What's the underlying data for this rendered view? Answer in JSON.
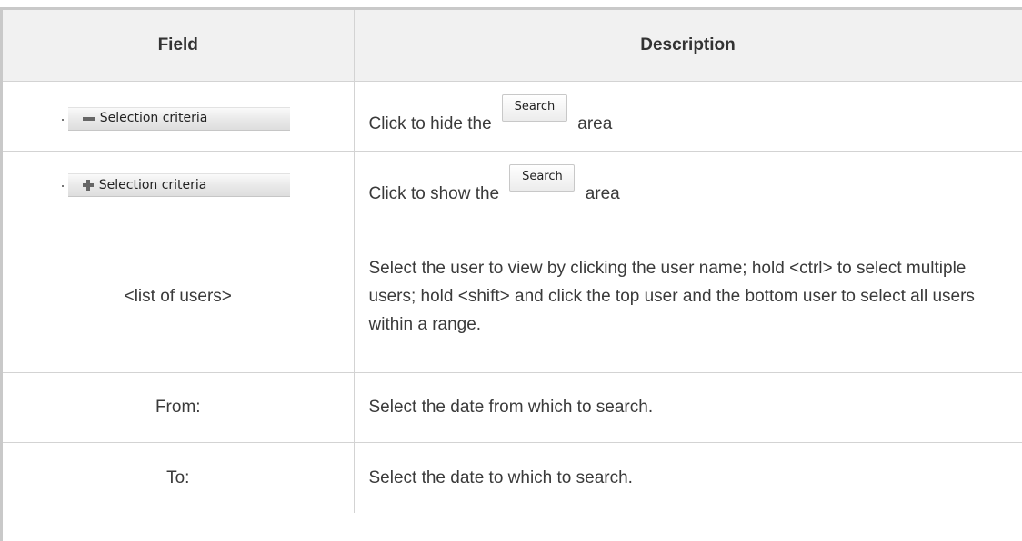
{
  "table": {
    "headers": {
      "field": "Field",
      "description": "Description"
    },
    "rows": {
      "hide": {
        "field_button_label": "Selection criteria",
        "field_button_icon": "minus-icon",
        "desc_before": "Click to hide the",
        "desc_button": "Search",
        "desc_after": "area"
      },
      "show": {
        "field_button_label": "Selection criteria",
        "field_button_icon": "plus-icon",
        "desc_before": "Click to show the",
        "desc_button": "Search",
        "desc_after": "area"
      },
      "list": {
        "field": "<list of users>",
        "desc": "Select the user to view by clicking the user name; hold <ctrl> to select multiple users; hold <shift> and click the top user and the bottom user to select all users within a range."
      },
      "from": {
        "field": "From:",
        "desc": "Select the date from which to search."
      },
      "to": {
        "field": "To:",
        "desc": "Select the date to which to search."
      }
    }
  },
  "colors": {
    "header_bg": "#f1f1f1",
    "rule": "#c9c9c9",
    "cell_border": "#d3d3d3",
    "text": "#3a3a3a"
  }
}
